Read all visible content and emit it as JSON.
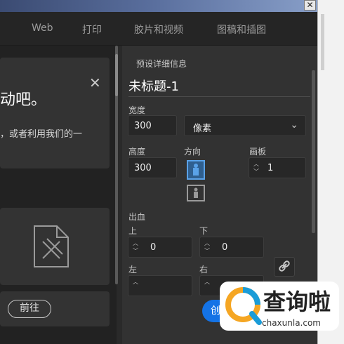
{
  "tabs": [
    "Web",
    "打印",
    "胶片和视频",
    "图稿和插图"
  ],
  "window_close": "✕",
  "content": {
    "big_text": "动吧。",
    "sub_text": "，或者利用我们的一",
    "close_symbol": "✕",
    "go_button": "前往"
  },
  "panel": {
    "header": "预设详细信息",
    "doc_title": "未标题-1",
    "width_label": "宽度",
    "width_value": "300",
    "unit": "像素",
    "height_label": "高度",
    "height_value": "300",
    "orientation_label": "方向",
    "artboard_label": "画板",
    "artboard_value": "1",
    "bleed_label": "出血",
    "bleed_top_label": "上",
    "bleed_top_value": "0",
    "bleed_bottom_label": "下",
    "bleed_bottom_value": "0",
    "bleed_left_label": "左",
    "bleed_right_label": "右",
    "create_button": "创"
  },
  "watermark": {
    "cn": "查询啦",
    "en": "chaxunla.com"
  }
}
